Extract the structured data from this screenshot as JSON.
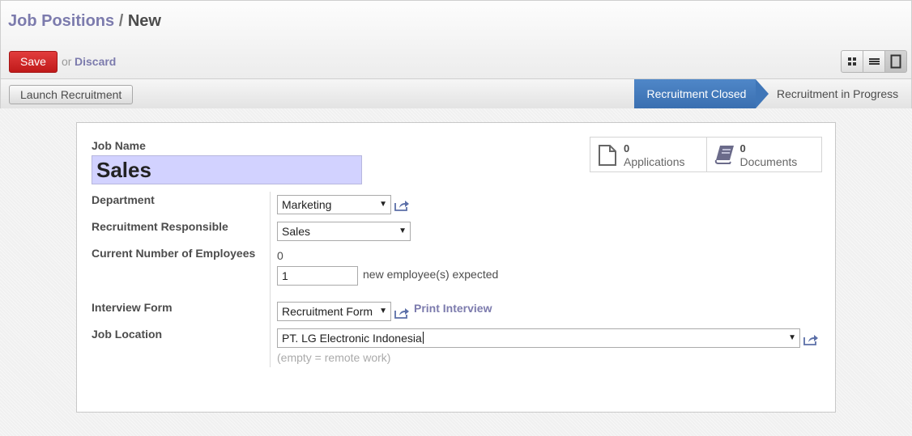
{
  "breadcrumb": {
    "parent": "Job Positions",
    "separator": "/",
    "current": "New"
  },
  "actions": {
    "save_label": "Save",
    "or_text": "or",
    "discard_label": "Discard"
  },
  "views": [
    "kanban-view-icon",
    "list-view-icon",
    "form-view-icon"
  ],
  "statusbar": {
    "launch_label": "Launch Recruitment",
    "stages": [
      {
        "label": "Recruitment Closed",
        "active": true
      },
      {
        "label": "Recruitment in Progress",
        "active": false
      }
    ]
  },
  "smart_buttons": [
    {
      "count": "0",
      "label": "Applications",
      "icon": "file-icon"
    },
    {
      "count": "0",
      "label": "Documents",
      "icon": "book-icon"
    }
  ],
  "form": {
    "job_name_label": "Job Name",
    "job_name_value": "Sales",
    "department_label": "Department",
    "department_value": "Marketing",
    "responsible_label": "Recruitment Responsible",
    "responsible_value": "Sales",
    "employees_label": "Current Number of Employees",
    "employees_value": "0",
    "expected_value": "1",
    "expected_suffix": "new employee(s) expected",
    "interview_label": "Interview Form",
    "interview_value": "Recruitment Form",
    "print_interview": "Print Interview",
    "location_label": "Job Location",
    "location_value": "PT. LG Electronic Indonesia",
    "location_hint": "(empty = remote work)"
  },
  "colors": {
    "accent": "#7c7bad",
    "save": "#d12b2b",
    "stage_active": "#4279bd",
    "name_field_bg": "#d2d2ff"
  }
}
